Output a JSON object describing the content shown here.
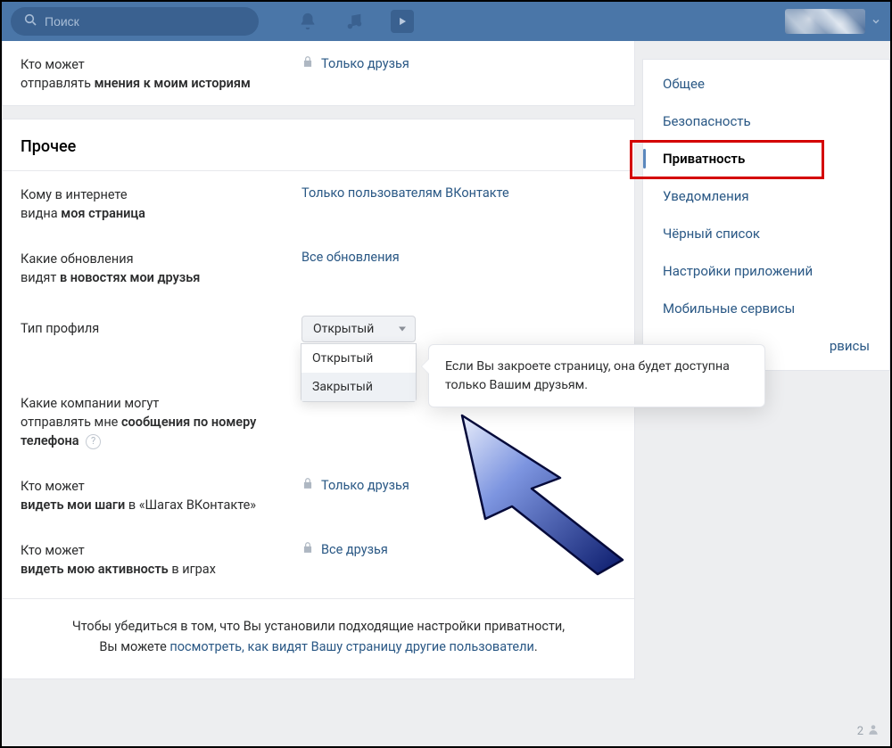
{
  "topbar": {
    "search_placeholder": "Поиск"
  },
  "section_top": {
    "label_line1": "Кто может",
    "label_line2_prefix": "отправлять ",
    "label_line2_bold": "мнения к моим историям",
    "value": "Только друзья"
  },
  "section_other": {
    "title": "Прочее",
    "rows": {
      "r0": {
        "l1": "Кому в интернете",
        "l2_prefix": "видна ",
        "l2_bold": "моя страница",
        "value": "Только пользователям ВКонтакте"
      },
      "r1": {
        "l1": "Какие обновления",
        "l2_prefix": "видят ",
        "l2_bold": "в новостях мои друзья",
        "value": "Все обновления"
      },
      "r2": {
        "l1": "Тип профиля",
        "selected": "Открытый",
        "options": {
          "o0": "Открытый",
          "o1": "Закрытый"
        },
        "tooltip": "Если Вы закроете страницу, она будет доступна только Вашим друзьям."
      },
      "r3": {
        "l1": "Какие компании могут",
        "l2_prefix": "отправлять мне ",
        "l2_bold": "сообщения по номеру телефона"
      },
      "r4": {
        "l1": "Кто может",
        "l2_prefix": "",
        "l2_bold": "видеть мои шаги",
        "l2_suffix": " в «Шагах ВКонтакте»",
        "value": "Только друзья"
      },
      "r5": {
        "l1": "Кто может",
        "l2_prefix": "",
        "l2_bold": "видеть мою активность",
        "l2_suffix": " в играх",
        "value": "Все друзья"
      }
    },
    "footer": {
      "text1": "Чтобы убедиться в том, что Вы установили подходящие настройки приватности,",
      "text2_prefix": "Вы можете ",
      "text2_link": "посмотреть, как видят Вашу страницу другие пользователи",
      "text2_suffix": "."
    }
  },
  "sidebar": {
    "items": {
      "i0": "Общее",
      "i1": "Безопасность",
      "i2": "Приватность",
      "i3": "Уведомления",
      "i4": "Чёрный список",
      "i5": "Настройки приложений",
      "i6": "Мобильные сервисы",
      "i7_partial": "рвисы"
    }
  },
  "presence": {
    "count": "2"
  }
}
